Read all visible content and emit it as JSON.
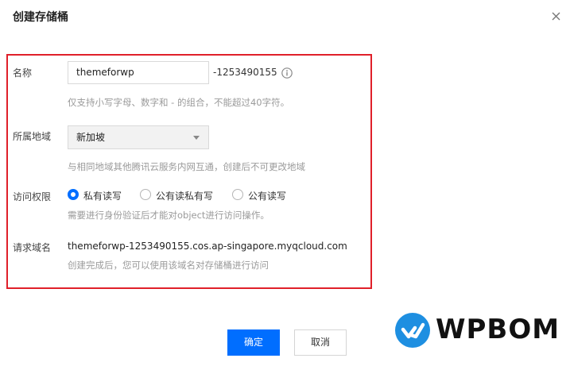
{
  "dialog": {
    "title": "创建存储桶"
  },
  "form": {
    "name": {
      "label": "名称",
      "value": "themeforwp",
      "suffix": "-1253490155",
      "hint": "仅支持小写字母、数字和 - 的组合，不能超过40字符。"
    },
    "region": {
      "label": "所属地域",
      "selected": "新加坡",
      "hint": "与相同地域其他腾讯云服务内网互通，创建后不可更改地域"
    },
    "access": {
      "label": "访问权限",
      "options": [
        "私有读写",
        "公有读私有写",
        "公有读写"
      ],
      "selected_index": 0,
      "hint": "需要进行身份验证后才能对object进行访问操作。"
    },
    "domain": {
      "label": "请求域名",
      "value": "themeforwp-1253490155.cos.ap-singapore.myqcloud.com",
      "hint": "创建完成后，您可以使用该域名对存储桶进行访问"
    }
  },
  "buttons": {
    "ok": "确定",
    "cancel": "取消"
  },
  "watermark": {
    "text": "WPBOM",
    "color": "#1e8fe1"
  },
  "colors": {
    "primary": "#006eff",
    "highlight_border": "#e0202a"
  }
}
